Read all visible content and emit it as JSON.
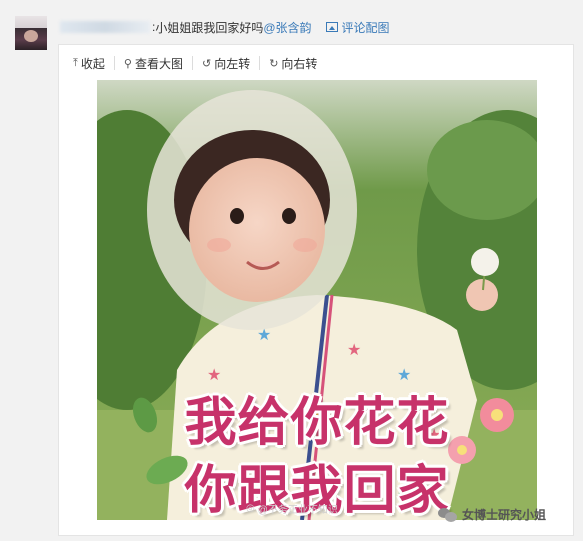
{
  "comment": {
    "separator": ":",
    "text": "小姐姐跟我回家好吗",
    "mention": "@张含韵",
    "attachment_label": "评论配图"
  },
  "toolbar": {
    "collapse": "收起",
    "view_large": "查看大图",
    "rotate_left": "向左转",
    "rotate_right": "向右转"
  },
  "image": {
    "caption_line1": "我给你花花",
    "caption_line2": "你跟我回家",
    "watermark_left": "@不务正业不知识",
    "watermark_right": "女博士研究小姐"
  },
  "icons": {
    "collapse": "arrow-up-icon",
    "view_large": "magnifier-icon",
    "rotate_left": "rotate-left-icon",
    "rotate_right": "rotate-right-icon",
    "attachment": "picture-icon"
  },
  "colors": {
    "link": "#3a7ab8",
    "caption": "#c7326a"
  }
}
